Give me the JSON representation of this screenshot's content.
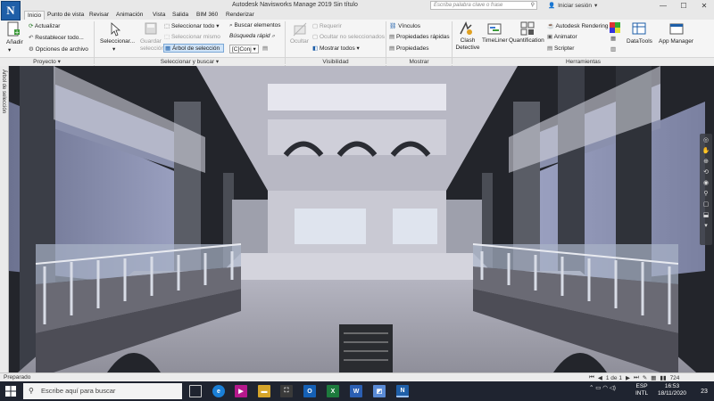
{
  "window": {
    "title": "Autodesk Navisworks Manage 2019   Sin título",
    "search_placeholder": "Escriba palabra clave o frase",
    "signin": "Iniciar sesión",
    "min": "—",
    "max": "☐",
    "close": "✕",
    "logo": "N"
  },
  "tabs": [
    "Inicio",
    "Punto de vista",
    "Revisar",
    "Animación",
    "Vista",
    "Salida",
    "BIM 360",
    "Renderizar"
  ],
  "ribbon": {
    "project": {
      "add": "Añadir",
      "refresh": "Actualizar",
      "reset_all": "Restablecer todo...",
      "file_options": "Opciones de archivo",
      "group_label": "Proyecto ▾"
    },
    "select": {
      "select": "Seleccionar...",
      "save_selection": "Guardar selección",
      "select_all": "Seleccionar todo",
      "select_same": "Seleccionar mismo",
      "selection_tree": "Árbol de selección",
      "find_items": "Buscar elementos",
      "quick_find": "Búsqueda rápid",
      "sets": "Conj",
      "group_label": "Seleccionar y buscar ▾"
    },
    "visibility": {
      "hide": "Ocultar",
      "require": "Requerir",
      "hide_unselected": "Ocultar no seleccionados",
      "show_all": "Mostrar todos",
      "group_label": "Visibilidad"
    },
    "show": {
      "links": "Vínculos",
      "quick_properties": "Propiedades rápidas",
      "properties": "Propiedades",
      "group_label": "Mostrar"
    },
    "tools": {
      "clash": "Clash Detective",
      "timeliner": "TimeLiner",
      "quantification": "Quantification",
      "rendering": "Autodesk Rendering",
      "animator": "Animator",
      "scripter": "Scripter",
      "datatools": "DataTools",
      "appmanager": "App Manager",
      "group_label": "Herramientas"
    }
  },
  "side_panel": {
    "label": "Árbol de selección"
  },
  "status": {
    "text": "Preparado",
    "page": "1 de 1",
    "memory": "724"
  },
  "taskbar": {
    "search": "Escribe aquí para buscar",
    "lang_top": "ESP",
    "lang_bottom": "INTL",
    "time": "16:53",
    "date": "18/11/2020",
    "notifications": "23"
  }
}
